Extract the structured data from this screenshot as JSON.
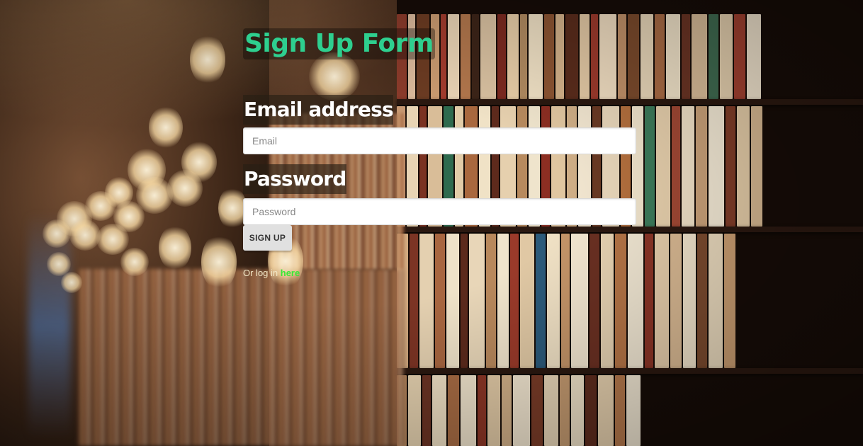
{
  "form": {
    "title": "Sign Up Form",
    "email_label": "Email address",
    "email_placeholder": "Email",
    "email_value": "",
    "password_label": "Password",
    "password_placeholder": "Password",
    "password_value": "",
    "submit_label": "SIGN UP",
    "login_prefix": "Or log in ",
    "login_link": "here"
  },
  "colors": {
    "title": "#2ecf8f",
    "link": "#39e835",
    "label": "#ffffff"
  }
}
